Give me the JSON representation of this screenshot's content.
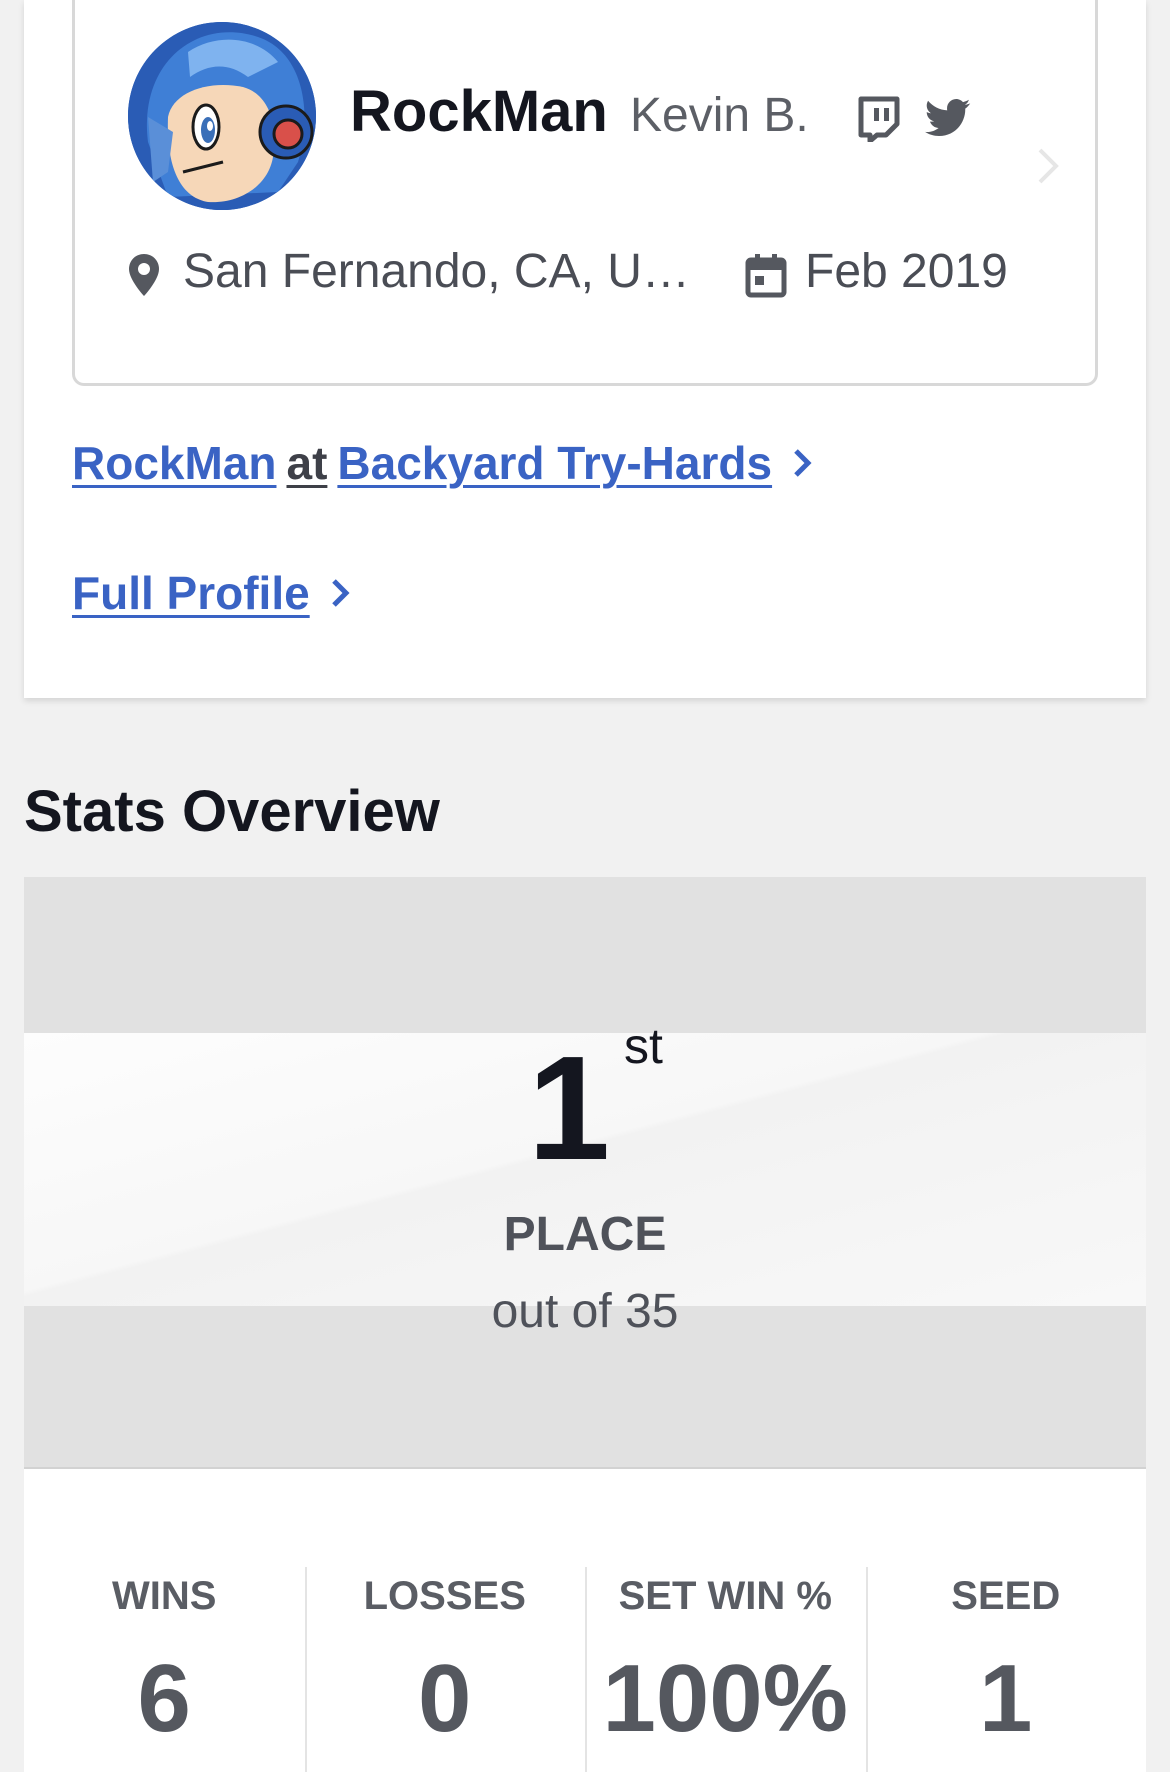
{
  "profile": {
    "gamer_tag": "RockMan",
    "real_name": "Kevin B.",
    "location": "San Fernando, CA, Un...",
    "joined": "Feb 2019",
    "icons": {
      "avatar": "megaman-avatar",
      "twitch": "twitch-icon",
      "twitter": "twitter-icon",
      "location": "pin-icon",
      "joined": "calendar-icon",
      "navigate": "chevron-right-icon"
    }
  },
  "links": {
    "player_name": "RockMan",
    "at": "at",
    "tournament": "Backyard Try-Hards",
    "full_profile": "Full Profile"
  },
  "stats": {
    "title": "Stats Overview",
    "place": "1",
    "place_suffix": "st",
    "place_label": "PLACE",
    "out_of": "out of 35",
    "items": [
      {
        "label": "WINS",
        "value": "6"
      },
      {
        "label": "LOSSES",
        "value": "0"
      },
      {
        "label": "SET WIN %",
        "value": "100%"
      },
      {
        "label": "SEED",
        "value": "1"
      }
    ]
  },
  "colors": {
    "link": "#3a63c4",
    "text_dark": "#14161f",
    "text_muted": "#5c5f66",
    "panel_gray": "#e1e1e1"
  }
}
